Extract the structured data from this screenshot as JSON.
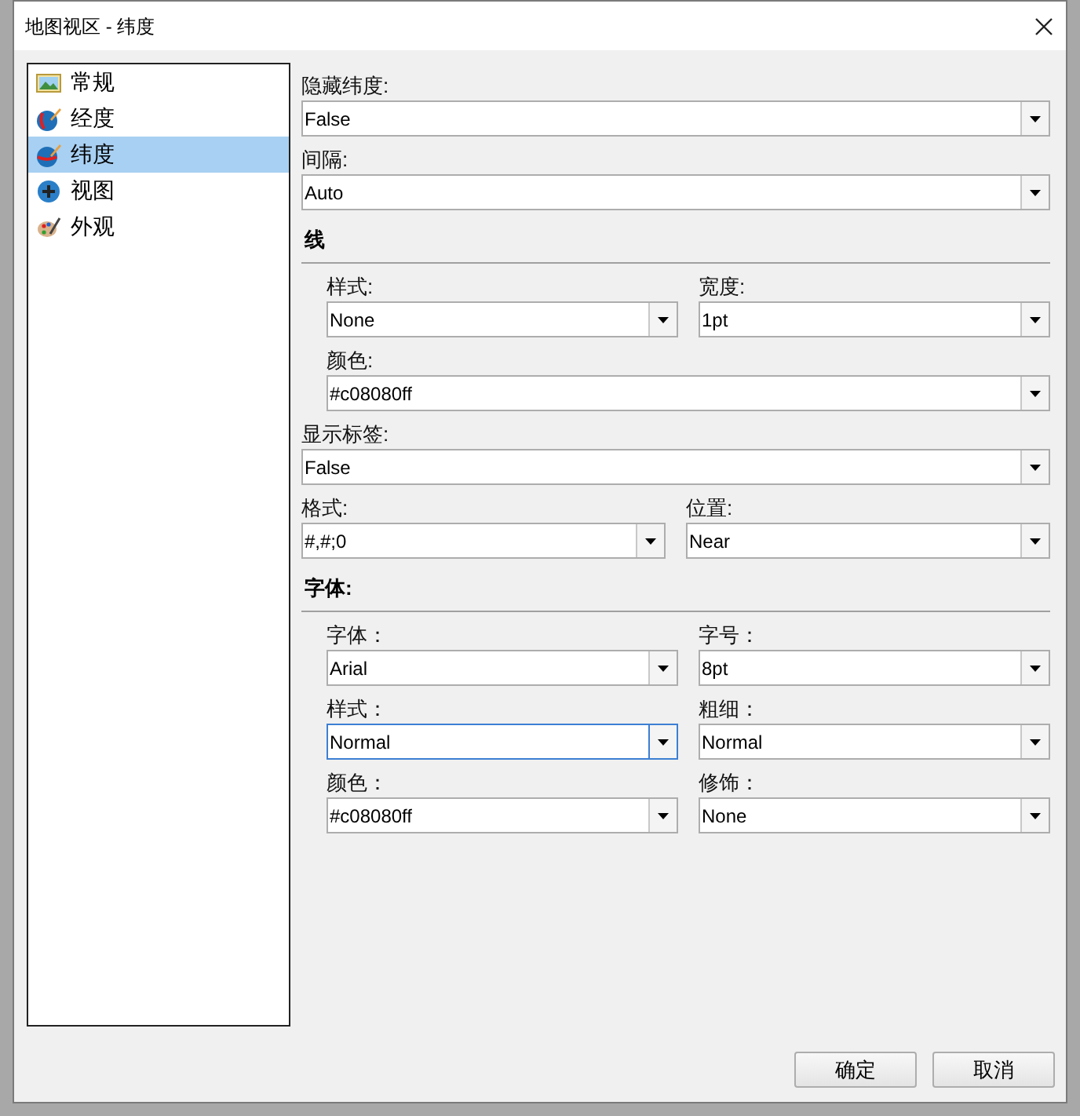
{
  "window": {
    "title": "地图视区 - 纬度"
  },
  "nav": [
    {
      "label": "常规",
      "kind": "general",
      "selected": false
    },
    {
      "label": "经度",
      "kind": "longitude",
      "selected": false
    },
    {
      "label": "纬度",
      "kind": "latitude",
      "selected": true
    },
    {
      "label": "视图",
      "kind": "view",
      "selected": false
    },
    {
      "label": "外观",
      "kind": "appearance",
      "selected": false
    }
  ],
  "form": [
    {
      "kind": "fields",
      "fields": [
        {
          "label": "隐藏纬度:",
          "value": "False",
          "focused": false
        }
      ]
    },
    {
      "kind": "fields",
      "fields": [
        {
          "label": "间隔:",
          "value": "Auto",
          "focused": false
        }
      ]
    },
    {
      "kind": "section",
      "label": "线",
      "children": [
        {
          "kind": "fields",
          "fields": [
            {
              "label": "样式:",
              "value": "None",
              "focused": false
            },
            {
              "label": "宽度:",
              "value": "1pt",
              "focused": false
            }
          ]
        },
        {
          "kind": "fields",
          "fields": [
            {
              "label": "颜色:",
              "value": "#c08080ff",
              "focused": false
            }
          ]
        }
      ]
    },
    {
      "kind": "fields",
      "fields": [
        {
          "label": "显示标签:",
          "value": "False",
          "focused": false
        }
      ]
    },
    {
      "kind": "fields",
      "fields": [
        {
          "label": "格式:",
          "value": "#,#;0",
          "focused": false
        },
        {
          "label": "位置:",
          "value": "Near",
          "focused": false
        }
      ]
    },
    {
      "kind": "section",
      "label": "字体:",
      "children": [
        {
          "kind": "fields",
          "fields": [
            {
              "label": "字体：",
              "value": "Arial",
              "focused": false
            },
            {
              "label": "字号：",
              "value": "8pt",
              "focused": false
            }
          ]
        },
        {
          "kind": "fields",
          "fields": [
            {
              "label": "样式：",
              "value": "Normal",
              "focused": true
            },
            {
              "label": "粗细：",
              "value": "Normal",
              "focused": false
            }
          ]
        },
        {
          "kind": "fields",
          "fields": [
            {
              "label": "颜色：",
              "value": "#c08080ff",
              "focused": false
            },
            {
              "label": "修饰：",
              "value": "None",
              "focused": false
            }
          ]
        }
      ]
    }
  ],
  "buttons": [
    {
      "label": "确定"
    },
    {
      "label": "取消"
    }
  ]
}
